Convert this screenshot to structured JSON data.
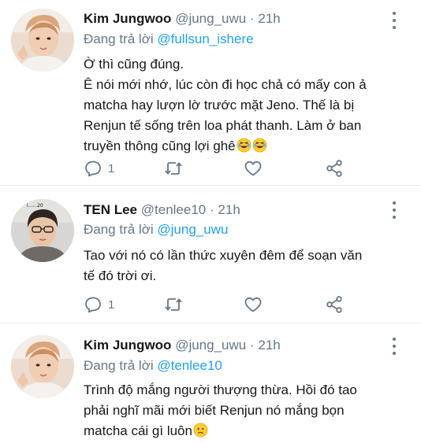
{
  "tweets": [
    {
      "author_name": "Kim Jungwoo",
      "author_handle": "@jung_uwu",
      "separator": "·",
      "time": "21h",
      "reply_label": "Đang trả lời",
      "reply_to": "@fullsun_ishere",
      "text_lines": [
        "Ờ thì cũng đúng.",
        "Ê nói mới nhớ, lúc còn đi học chả có mấy con ả",
        "matcha hay lượn lờ trước mặt Jeno. Thế là bị",
        "Renjun tế sống trên loa phát thanh. Làm ở ban",
        "truyền thông cũng lợi ghê"
      ],
      "emojis": [
        "laughing-emoji",
        "laughing-emoji"
      ],
      "reply_count": "1",
      "avatar_icon": "profile-photo"
    },
    {
      "author_name": "TEN Lee",
      "author_handle": "@tenlee10",
      "separator": "·",
      "time": "21h",
      "reply_label": "Đang trả lời",
      "reply_to": "@jung_uwu",
      "text_lines": [
        "Tao với nó có lần thức xuyên đêm để soạn văn",
        "tế đó trời ơi."
      ],
      "reply_count": "1",
      "avatar_icon": "profile-photo"
    },
    {
      "author_name": "Kim Jungwoo",
      "author_handle": "@jung_uwu",
      "separator": "·",
      "time": "21h",
      "reply_label": "Đang trả lời",
      "reply_to": "@tenlee10",
      "text_lines": [
        "Trình độ mắng người thượng thừa. Hồi đó tao",
        "phải nghĩ mãi mới biết Renjun nó mắng bọn",
        "matcha cái gì luôn"
      ],
      "emojis": [
        "confused-emoji"
      ],
      "avatar_icon": "profile-photo"
    }
  ],
  "colors": {
    "text": "#14171a",
    "secondary": "#657786",
    "link": "#1da1f2",
    "divider": "#e6ecf0"
  }
}
